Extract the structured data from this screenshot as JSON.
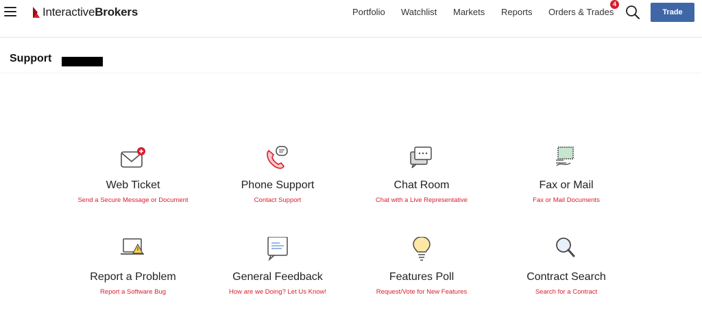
{
  "header": {
    "brand_regular": "Interactive",
    "brand_bold": "Brokers",
    "nav": [
      {
        "label": "Portfolio"
      },
      {
        "label": "Watchlist"
      },
      {
        "label": "Markets"
      },
      {
        "label": "Reports"
      },
      {
        "label": "Orders & Trades"
      }
    ],
    "orders_badge": "4",
    "trade_label": "Trade"
  },
  "page": {
    "title": "Support"
  },
  "cards": [
    {
      "title": "Web Ticket",
      "subtitle": "Send a Secure Message or Document",
      "icon": "envelope-plus-icon"
    },
    {
      "title": "Phone Support",
      "subtitle": "Contact Support",
      "icon": "phone-icon"
    },
    {
      "title": "Chat Room",
      "subtitle": "Chat with a Live Representative",
      "icon": "chat-icon"
    },
    {
      "title": "Fax or Mail",
      "subtitle": "Fax or Mail Documents",
      "icon": "fax-mail-icon"
    },
    {
      "title": "Report a Problem",
      "subtitle": "Report a Software Bug",
      "icon": "laptop-warning-icon"
    },
    {
      "title": "General Feedback",
      "subtitle": "How are we Doing? Let Us Know!",
      "icon": "feedback-icon"
    },
    {
      "title": "Features Poll",
      "subtitle": "Request/Vote for New Features",
      "icon": "lightbulb-icon"
    },
    {
      "title": "Contract Search",
      "subtitle": "Search for a Contract",
      "icon": "magnifier-icon"
    }
  ],
  "colors": {
    "accent_red": "#d81e2c",
    "trade_blue": "#3f67a7",
    "icon_grey": "#4a4a4a",
    "icon_fill_green": "#c7e6cf",
    "icon_fill_yellow": "#ffe8a3"
  }
}
